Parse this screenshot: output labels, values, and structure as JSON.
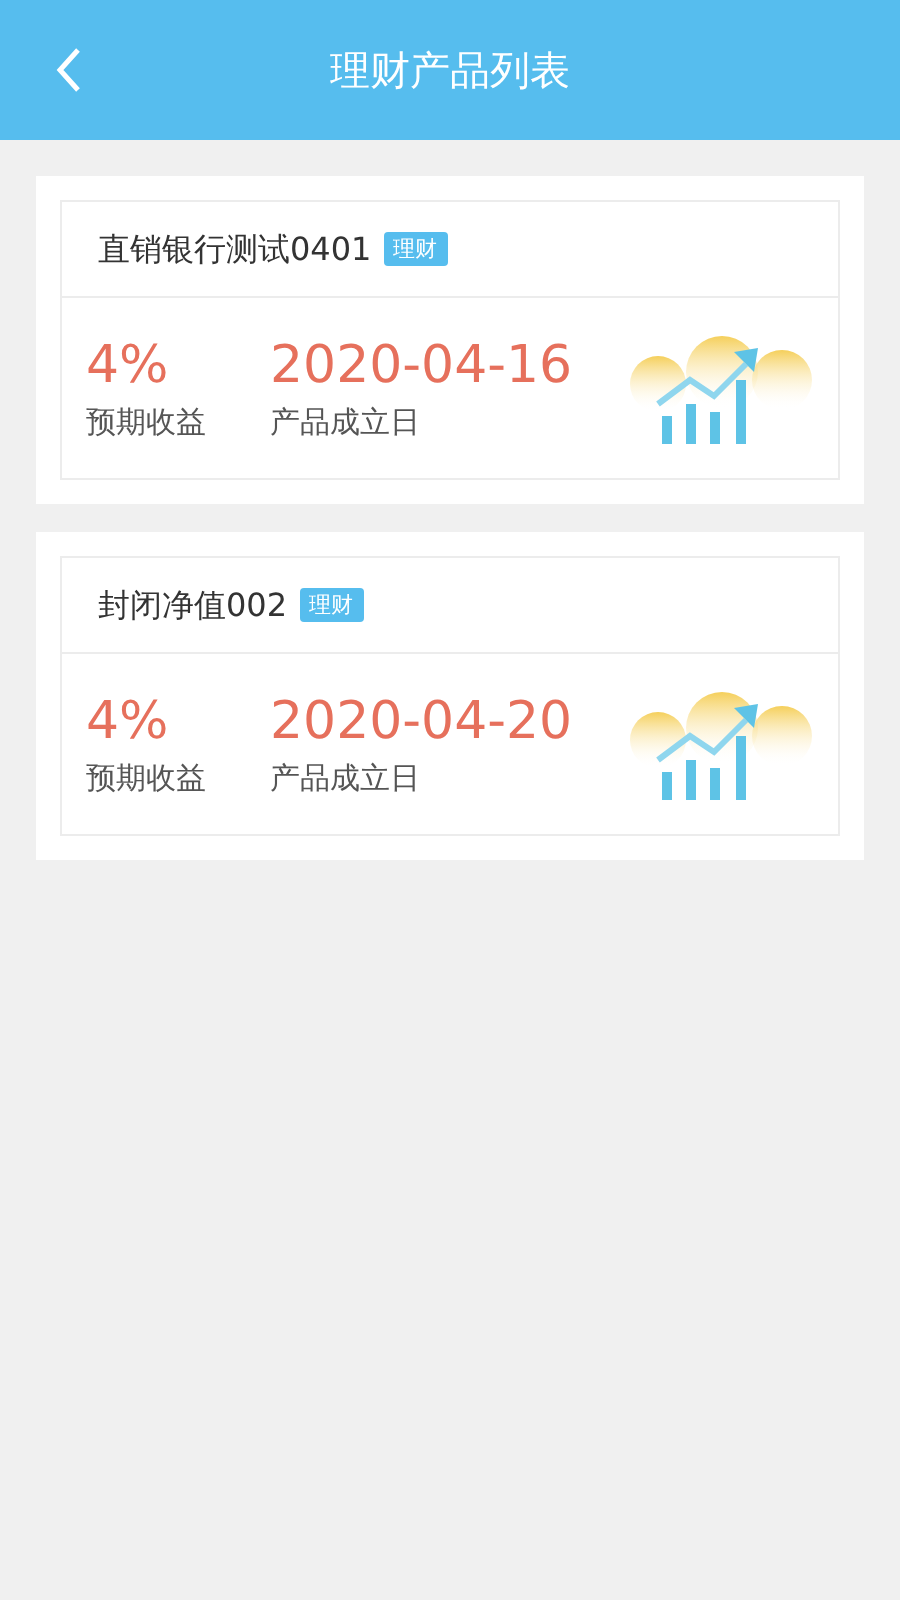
{
  "header": {
    "title": "理财产品列表"
  },
  "products": [
    {
      "name": "直销银行测试0401",
      "tag": "理财",
      "rate": "4%",
      "rate_label": "预期收益",
      "date": "2020-04-16",
      "date_label": "产品成立日"
    },
    {
      "name": "封闭净值002",
      "tag": "理财",
      "rate": "4%",
      "rate_label": "预期收益",
      "date": "2020-04-20",
      "date_label": "产品成立日"
    }
  ]
}
